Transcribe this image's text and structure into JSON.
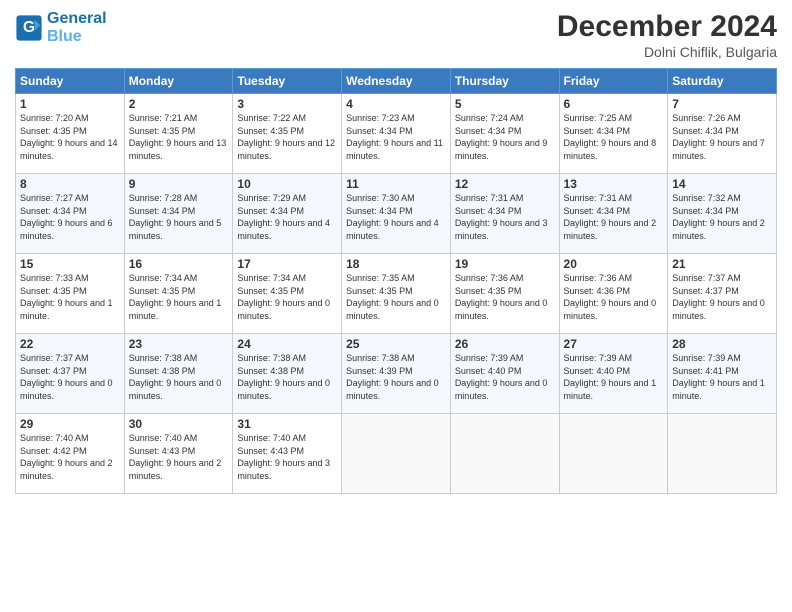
{
  "logo": {
    "line1": "General",
    "line2": "Blue"
  },
  "header": {
    "month": "December 2024",
    "location": "Dolni Chiflik, Bulgaria"
  },
  "weekdays": [
    "Sunday",
    "Monday",
    "Tuesday",
    "Wednesday",
    "Thursday",
    "Friday",
    "Saturday"
  ],
  "weeks": [
    [
      {
        "day": "1",
        "sunrise": "Sunrise: 7:20 AM",
        "sunset": "Sunset: 4:35 PM",
        "daylight": "Daylight: 9 hours and 14 minutes."
      },
      {
        "day": "2",
        "sunrise": "Sunrise: 7:21 AM",
        "sunset": "Sunset: 4:35 PM",
        "daylight": "Daylight: 9 hours and 13 minutes."
      },
      {
        "day": "3",
        "sunrise": "Sunrise: 7:22 AM",
        "sunset": "Sunset: 4:35 PM",
        "daylight": "Daylight: 9 hours and 12 minutes."
      },
      {
        "day": "4",
        "sunrise": "Sunrise: 7:23 AM",
        "sunset": "Sunset: 4:34 PM",
        "daylight": "Daylight: 9 hours and 11 minutes."
      },
      {
        "day": "5",
        "sunrise": "Sunrise: 7:24 AM",
        "sunset": "Sunset: 4:34 PM",
        "daylight": "Daylight: 9 hours and 9 minutes."
      },
      {
        "day": "6",
        "sunrise": "Sunrise: 7:25 AM",
        "sunset": "Sunset: 4:34 PM",
        "daylight": "Daylight: 9 hours and 8 minutes."
      },
      {
        "day": "7",
        "sunrise": "Sunrise: 7:26 AM",
        "sunset": "Sunset: 4:34 PM",
        "daylight": "Daylight: 9 hours and 7 minutes."
      }
    ],
    [
      {
        "day": "8",
        "sunrise": "Sunrise: 7:27 AM",
        "sunset": "Sunset: 4:34 PM",
        "daylight": "Daylight: 9 hours and 6 minutes."
      },
      {
        "day": "9",
        "sunrise": "Sunrise: 7:28 AM",
        "sunset": "Sunset: 4:34 PM",
        "daylight": "Daylight: 9 hours and 5 minutes."
      },
      {
        "day": "10",
        "sunrise": "Sunrise: 7:29 AM",
        "sunset": "Sunset: 4:34 PM",
        "daylight": "Daylight: 9 hours and 4 minutes."
      },
      {
        "day": "11",
        "sunrise": "Sunrise: 7:30 AM",
        "sunset": "Sunset: 4:34 PM",
        "daylight": "Daylight: 9 hours and 4 minutes."
      },
      {
        "day": "12",
        "sunrise": "Sunrise: 7:31 AM",
        "sunset": "Sunset: 4:34 PM",
        "daylight": "Daylight: 9 hours and 3 minutes."
      },
      {
        "day": "13",
        "sunrise": "Sunrise: 7:31 AM",
        "sunset": "Sunset: 4:34 PM",
        "daylight": "Daylight: 9 hours and 2 minutes."
      },
      {
        "day": "14",
        "sunrise": "Sunrise: 7:32 AM",
        "sunset": "Sunset: 4:34 PM",
        "daylight": "Daylight: 9 hours and 2 minutes."
      }
    ],
    [
      {
        "day": "15",
        "sunrise": "Sunrise: 7:33 AM",
        "sunset": "Sunset: 4:35 PM",
        "daylight": "Daylight: 9 hours and 1 minute."
      },
      {
        "day": "16",
        "sunrise": "Sunrise: 7:34 AM",
        "sunset": "Sunset: 4:35 PM",
        "daylight": "Daylight: 9 hours and 1 minute."
      },
      {
        "day": "17",
        "sunrise": "Sunrise: 7:34 AM",
        "sunset": "Sunset: 4:35 PM",
        "daylight": "Daylight: 9 hours and 0 minutes."
      },
      {
        "day": "18",
        "sunrise": "Sunrise: 7:35 AM",
        "sunset": "Sunset: 4:35 PM",
        "daylight": "Daylight: 9 hours and 0 minutes."
      },
      {
        "day": "19",
        "sunrise": "Sunrise: 7:36 AM",
        "sunset": "Sunset: 4:35 PM",
        "daylight": "Daylight: 9 hours and 0 minutes."
      },
      {
        "day": "20",
        "sunrise": "Sunrise: 7:36 AM",
        "sunset": "Sunset: 4:36 PM",
        "daylight": "Daylight: 9 hours and 0 minutes."
      },
      {
        "day": "21",
        "sunrise": "Sunrise: 7:37 AM",
        "sunset": "Sunset: 4:37 PM",
        "daylight": "Daylight: 9 hours and 0 minutes."
      }
    ],
    [
      {
        "day": "22",
        "sunrise": "Sunrise: 7:37 AM",
        "sunset": "Sunset: 4:37 PM",
        "daylight": "Daylight: 9 hours and 0 minutes."
      },
      {
        "day": "23",
        "sunrise": "Sunrise: 7:38 AM",
        "sunset": "Sunset: 4:38 PM",
        "daylight": "Daylight: 9 hours and 0 minutes."
      },
      {
        "day": "24",
        "sunrise": "Sunrise: 7:38 AM",
        "sunset": "Sunset: 4:38 PM",
        "daylight": "Daylight: 9 hours and 0 minutes."
      },
      {
        "day": "25",
        "sunrise": "Sunrise: 7:38 AM",
        "sunset": "Sunset: 4:39 PM",
        "daylight": "Daylight: 9 hours and 0 minutes."
      },
      {
        "day": "26",
        "sunrise": "Sunrise: 7:39 AM",
        "sunset": "Sunset: 4:40 PM",
        "daylight": "Daylight: 9 hours and 0 minutes."
      },
      {
        "day": "27",
        "sunrise": "Sunrise: 7:39 AM",
        "sunset": "Sunset: 4:40 PM",
        "daylight": "Daylight: 9 hours and 1 minute."
      },
      {
        "day": "28",
        "sunrise": "Sunrise: 7:39 AM",
        "sunset": "Sunset: 4:41 PM",
        "daylight": "Daylight: 9 hours and 1 minute."
      }
    ],
    [
      {
        "day": "29",
        "sunrise": "Sunrise: 7:40 AM",
        "sunset": "Sunset: 4:42 PM",
        "daylight": "Daylight: 9 hours and 2 minutes."
      },
      {
        "day": "30",
        "sunrise": "Sunrise: 7:40 AM",
        "sunset": "Sunset: 4:43 PM",
        "daylight": "Daylight: 9 hours and 2 minutes."
      },
      {
        "day": "31",
        "sunrise": "Sunrise: 7:40 AM",
        "sunset": "Sunset: 4:43 PM",
        "daylight": "Daylight: 9 hours and 3 minutes."
      },
      null,
      null,
      null,
      null
    ]
  ]
}
